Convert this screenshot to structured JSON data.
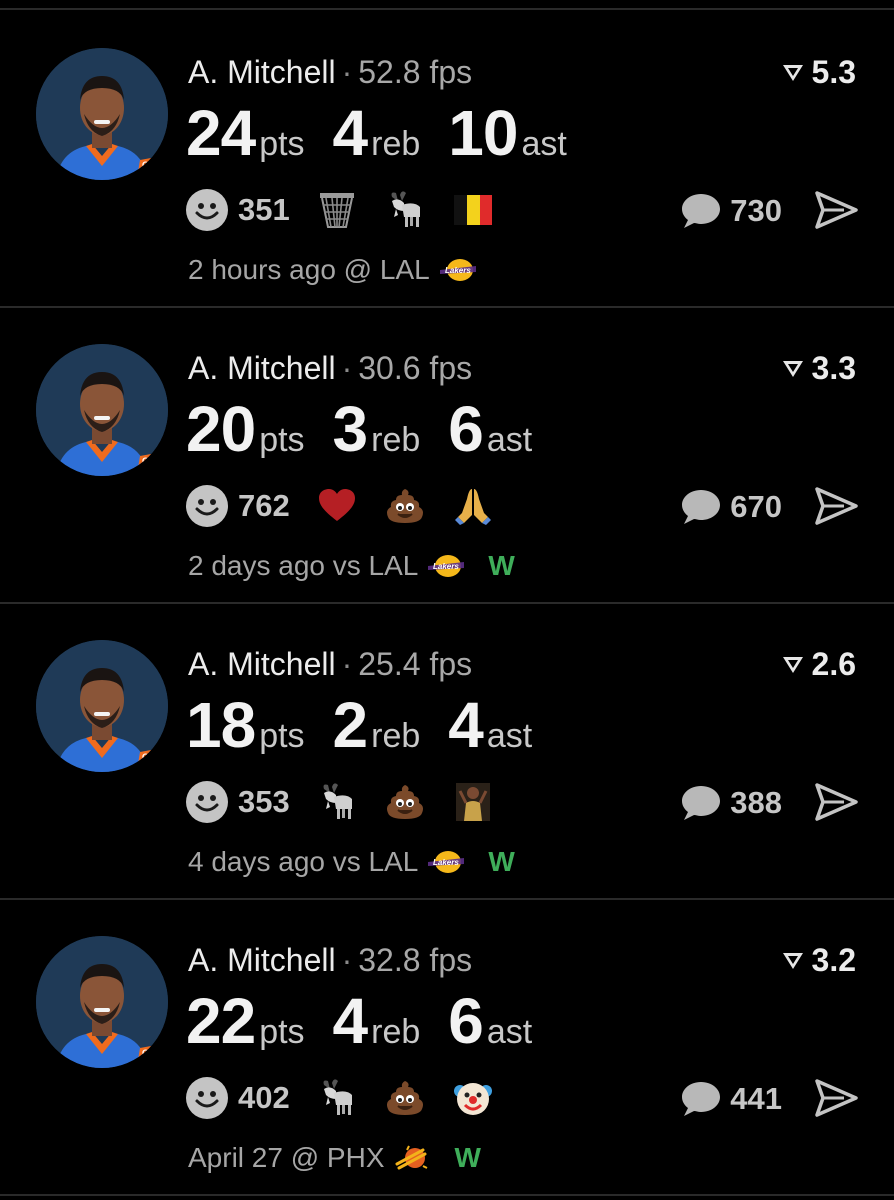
{
  "posts": [
    {
      "player": "A. Mitchell",
      "fps": "52.8 fps",
      "rating": "5.3",
      "stats": [
        {
          "value": "24",
          "unit": "pts"
        },
        {
          "value": "4",
          "unit": "reb"
        },
        {
          "value": "10",
          "unit": "ast"
        }
      ],
      "reaction_count": "351",
      "reaction_emojis": [
        "basketball-net-icon",
        "goat-icon",
        "belgium-flag-icon"
      ],
      "comment_count": "730",
      "time": "2 hours ago @ LAL",
      "team_logo": "lakers-logo-icon",
      "result": ""
    },
    {
      "player": "A. Mitchell",
      "fps": "30.6 fps",
      "rating": "3.3",
      "stats": [
        {
          "value": "20",
          "unit": "pts"
        },
        {
          "value": "3",
          "unit": "reb"
        },
        {
          "value": "6",
          "unit": "ast"
        }
      ],
      "reaction_count": "762",
      "reaction_emojis": [
        "heart-icon",
        "poop-icon",
        "praying-hands-icon"
      ],
      "comment_count": "670",
      "time": "2 days ago vs LAL",
      "team_logo": "lakers-logo-icon",
      "result": "W"
    },
    {
      "player": "A. Mitchell",
      "fps": "25.4 fps",
      "rating": "2.6",
      "stats": [
        {
          "value": "18",
          "unit": "pts"
        },
        {
          "value": "2",
          "unit": "reb"
        },
        {
          "value": "4",
          "unit": "ast"
        }
      ],
      "reaction_count": "353",
      "reaction_emojis": [
        "goat-icon",
        "poop-icon",
        "player-celebrating-icon"
      ],
      "comment_count": "388",
      "time": "4 days ago vs LAL",
      "team_logo": "lakers-logo-icon",
      "result": "W"
    },
    {
      "player": "A. Mitchell",
      "fps": "32.8 fps",
      "rating": "3.2",
      "stats": [
        {
          "value": "22",
          "unit": "pts"
        },
        {
          "value": "4",
          "unit": "reb"
        },
        {
          "value": "6",
          "unit": "ast"
        }
      ],
      "reaction_count": "402",
      "reaction_emojis": [
        "goat-icon",
        "poop-icon",
        "clown-face-icon"
      ],
      "comment_count": "441",
      "time": "April 27 @ PHX",
      "team_logo": "suns-logo-icon",
      "result": "W"
    }
  ],
  "colors": {
    "background": "#000000",
    "divider": "#2a2a2a",
    "win": "#3fae5a",
    "muted": "#a6a6a6"
  }
}
